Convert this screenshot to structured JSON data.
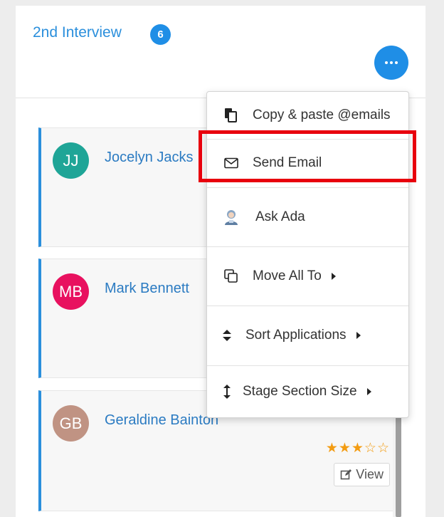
{
  "stage": {
    "title": "2nd Interview",
    "count": "6"
  },
  "candidates": [
    {
      "initials": "JJ",
      "name": "Jocelyn Jacks",
      "avatar_color": "#1fa597"
    },
    {
      "initials": "MB",
      "name": "Mark Bennett",
      "avatar_color": "#e8115f"
    },
    {
      "initials": "GB",
      "name": "Geraldine Bainton",
      "avatar_color": "#c09383",
      "rating": "★★★☆☆",
      "rating_value": 3,
      "view_label": "View"
    }
  ],
  "menu": {
    "items": [
      {
        "label": "Copy & paste @emails",
        "icon": "clipboard-icon"
      },
      {
        "label": "Send Email",
        "icon": "envelope-icon"
      },
      {
        "label": "Ask Ada",
        "icon": "ada-assistant-icon"
      },
      {
        "label": "Move All To",
        "icon": "copy-icon",
        "submenu": true
      },
      {
        "label": "Sort Applications",
        "icon": "sort-icon",
        "submenu": true
      },
      {
        "label": "Stage Section Size",
        "icon": "vertical-resize-icon",
        "submenu": true
      }
    ]
  },
  "colors": {
    "accent": "#1f8ee6",
    "highlight": "#e8000d",
    "star": "#f39c12"
  }
}
